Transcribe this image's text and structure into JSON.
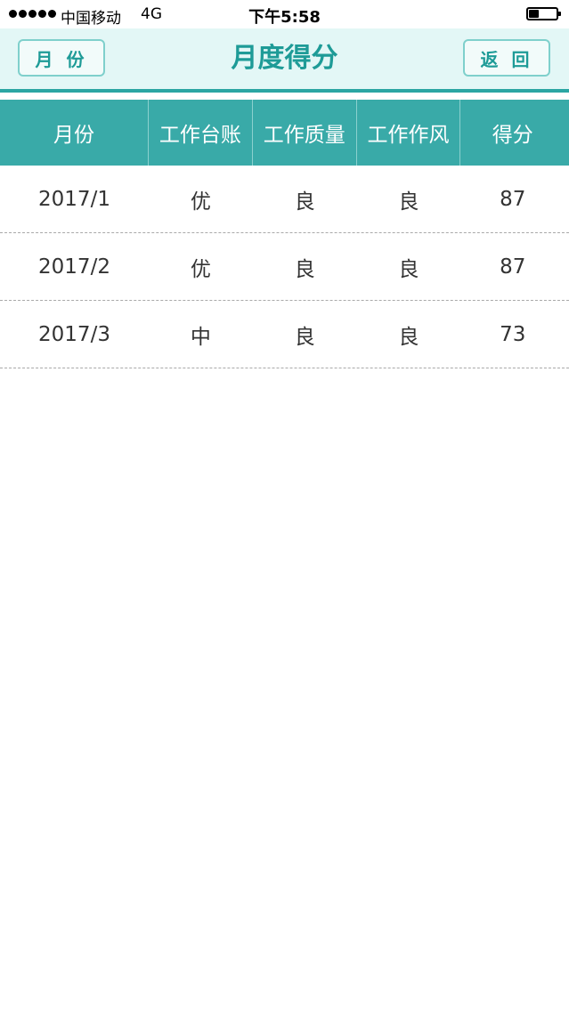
{
  "status_bar": {
    "carrier": "中国移动",
    "network": "4G",
    "time": "下午5:58",
    "signal_bars": 5,
    "battery_level": 0.35
  },
  "header": {
    "title": "月度得分",
    "left_button": "月 份",
    "right_button": "返 回",
    "accent_color": "#1e9b97",
    "background_color": "#e3f7f6"
  },
  "table": {
    "header_color": "#39aaa8",
    "columns": [
      "月份",
      "工作台账",
      "工作质量",
      "工作作风",
      "得分"
    ],
    "rows": [
      [
        "2017/1",
        "优",
        "良",
        "良",
        "87"
      ],
      [
        "2017/2",
        "优",
        "良",
        "良",
        "87"
      ],
      [
        "2017/3",
        "中",
        "良",
        "良",
        "73"
      ]
    ]
  }
}
